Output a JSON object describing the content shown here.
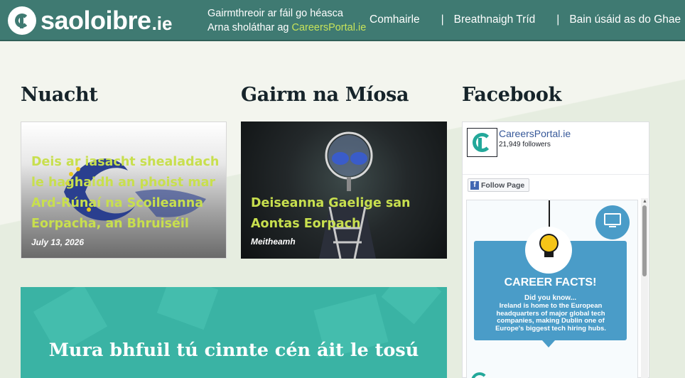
{
  "header": {
    "logo_text": "saoloibre",
    "logo_tld": ".ie",
    "tagline_line1": "Gairmthreoir ar fáil go héasca",
    "tagline_prefix": "Arna sholáthar ag ",
    "tagline_link": "CareersPortal.ie",
    "nav": [
      "Comhairle",
      "Breathnaigh Tríd",
      "Bain úsáid as do Ghae"
    ]
  },
  "sections": {
    "news_heading": "Nuacht",
    "month_heading": "Gairm na Míosa",
    "facebook_heading": "Facebook"
  },
  "news_card": {
    "title": "Deis ar iasacht shealadach le haghaidh an phoist mar Ard-Rúnaí na Scoileanna Eorpacha, an Bhruiséil",
    "date": "July 13, 2026"
  },
  "month_card": {
    "title": "Deiseanna Gaelige san Aontas Eorpach",
    "category": "Meitheamh"
  },
  "facebook": {
    "page_name": "CareersPortal.ie",
    "followers": "21,949 followers",
    "follow_label": "Follow Page",
    "post": {
      "title": "CAREER FACTS!",
      "subtitle": "Did you know...",
      "body": "Ireland is home to the European headquarters of major global tech companies, making Dublin one of Europe's biggest tech hiring hubs."
    }
  },
  "cta": {
    "title": "Mura bhfuil tú cinnte cén áit le tosú"
  },
  "colors": {
    "header_bg": "#3f7a72",
    "accent_green": "#c8df4e",
    "teal": "#3ab3a4",
    "facebook_blue": "#4267b2"
  }
}
